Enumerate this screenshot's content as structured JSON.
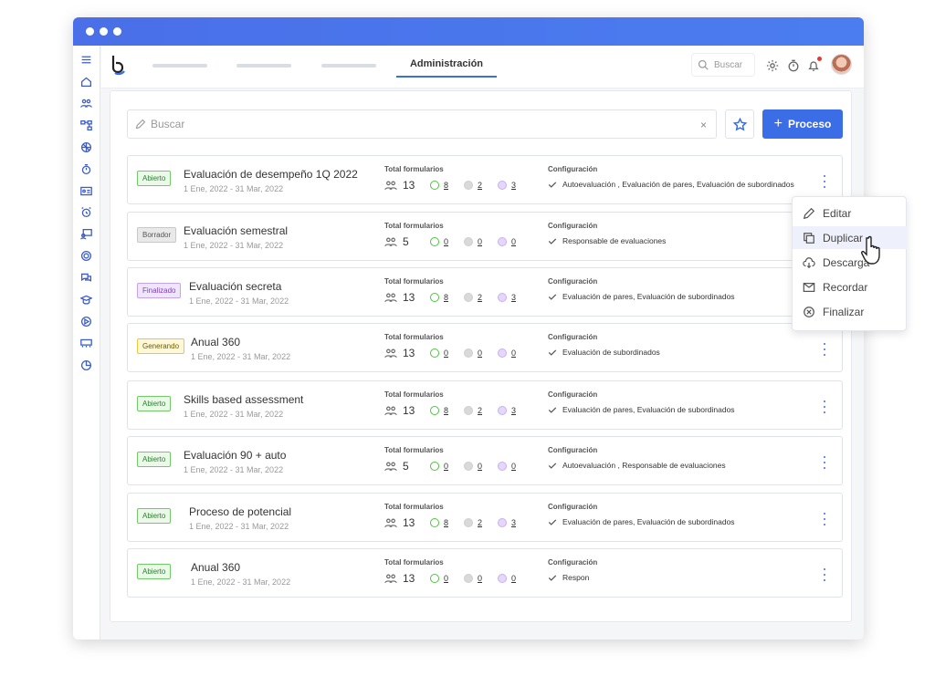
{
  "topbar": {
    "active_tab": "Administración",
    "search_placeholder": "Buscar"
  },
  "panel": {
    "search_placeholder": "Buscar",
    "clear_symbol": "×",
    "new_process_label": "Proceso"
  },
  "labels": {
    "total_forms": "Total formularios",
    "configuration": "Configuración"
  },
  "rows": [
    {
      "status": "Abierto",
      "status_color": "green",
      "title": "Evaluación de desempeño 1Q 2022",
      "date": "1 Ene, 2022 - 31 Mar, 2022",
      "total": "13",
      "completed": "8",
      "pending": "2",
      "other": "3",
      "config": "Autoevaluación ,  Evaluación de pares, Evaluación de subordinados"
    },
    {
      "status": "Borrador",
      "status_color": "gray",
      "title": "Evaluación semestral",
      "date": "1 Ene, 2022 - 31 Mar, 2022",
      "total": "5",
      "completed": "0",
      "pending": "0",
      "other": "0",
      "config": "Responsable de evaluaciones"
    },
    {
      "status": "Finalizado",
      "status_color": "purple",
      "title": "Evaluación secreta",
      "date": "1 Ene, 2022 - 31 Mar, 2022",
      "total": "13",
      "completed": "8",
      "pending": "2",
      "other": "3",
      "config": "Evaluación de pares, Evaluación de subordinados"
    },
    {
      "status": "Generando",
      "status_color": "yellow",
      "title": "Anual 360",
      "date": "1 Ene, 2022 - 31 Mar, 2022",
      "total": "13",
      "completed": "0",
      "pending": "0",
      "other": "0",
      "config": "Evaluación de subordinados"
    },
    {
      "status": "Abierto",
      "status_color": "green",
      "title": "Skills based assessment",
      "date": "1 Ene, 2022 - 31 Mar, 2022",
      "total": "13",
      "completed": "8",
      "pending": "2",
      "other": "3",
      "config": "Evaluación de pares, Evaluación de subordinados"
    },
    {
      "status": "Abierto",
      "status_color": "green",
      "title": "Evaluación 90 + auto",
      "date": "1 Ene, 2022 - 31 Mar, 2022",
      "total": "5",
      "completed": "0",
      "pending": "0",
      "other": "0",
      "config": "Autoevaluación ,  Responsable de evaluaciones"
    },
    {
      "status": "Abierto",
      "status_color": "green",
      "title": "Proceso de potencial",
      "date": "1 Ene, 2022 - 31 Mar, 2022",
      "total": "13",
      "completed": "8",
      "pending": "2",
      "other": "3",
      "config": "Evaluación de pares, Evaluación de subordinados"
    },
    {
      "status": "Abierto",
      "status_color": "green",
      "title": "Anual 360",
      "date": "1 Ene, 2022 - 31 Mar, 2022",
      "total": "13",
      "completed": "0",
      "pending": "0",
      "other": "0",
      "config": "Respon"
    }
  ],
  "context_menu": {
    "items": [
      {
        "label": "Editar",
        "icon": "pencil-icon"
      },
      {
        "label": "Duplicar",
        "icon": "copy-icon"
      },
      {
        "label": "Descarga",
        "icon": "cloud-download-icon"
      },
      {
        "label": "Recordar",
        "icon": "mail-icon"
      },
      {
        "label": "Finalizar",
        "icon": "circle-x-icon"
      }
    ],
    "hovered_item": "Duplicar"
  },
  "colors": {
    "accent": "#3b6de6",
    "titlebar": "#4a6fe8",
    "status_green": "#73c96a",
    "status_purple": "#c7a3ef",
    "status_yellow": "#e6c93f"
  }
}
